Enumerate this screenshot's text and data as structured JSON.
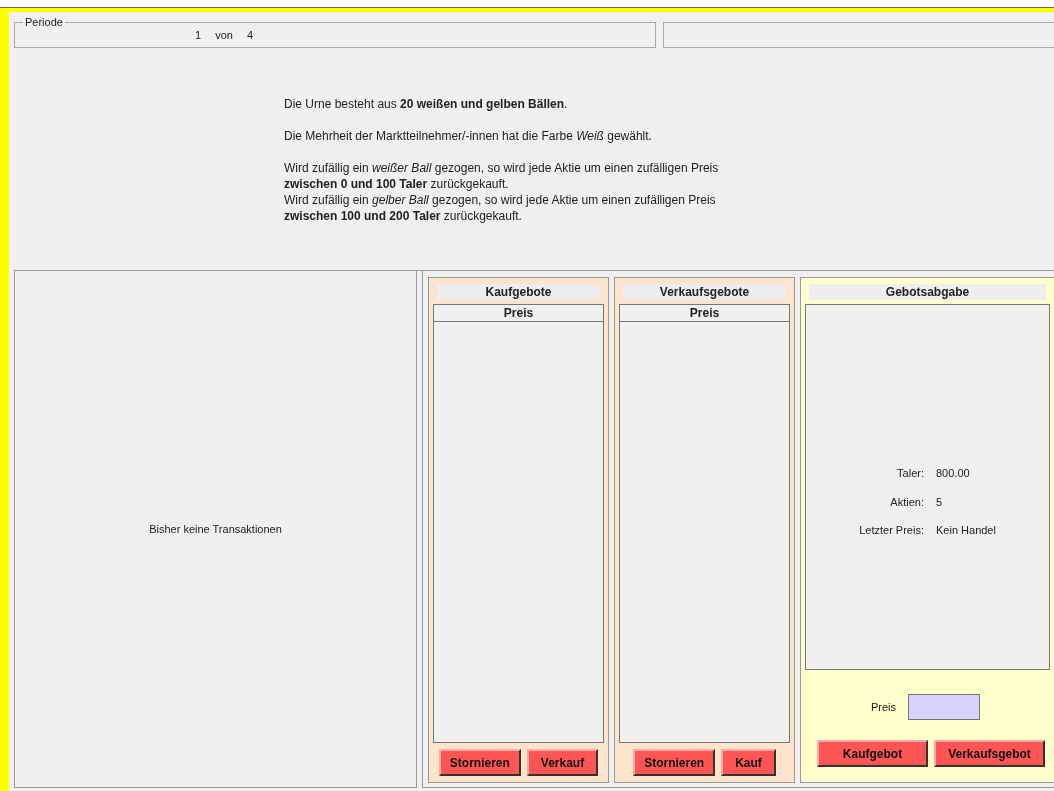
{
  "period": {
    "legend": "Periode",
    "current": "1",
    "separator": "von",
    "total": "4"
  },
  "info": {
    "paragraphs": [
      [
        "Die Urne besteht aus **20 weißen und gelben Bällen**."
      ],
      [
        "Die Mehrheit der Marktteilnehmer/-innen hat die Farbe *Weiß* gewählt."
      ],
      [
        "Wird zufällig ein *weißer Ball* gezogen, so wird jede Aktie um einen zufälligen Preis",
        "**zwischen 0 und 100 Taler** zurückgekauft.",
        "Wird zufällig ein *gelber Ball* gezogen, so wird jede Aktie um einen zufälligen Preis",
        "**zwischen 100 und 200 Taler** zurückgekauft."
      ]
    ]
  },
  "transactions": {
    "empty_message": "Bisher keine Transaktionen"
  },
  "order_books": [
    {
      "title": "Kaufgebote",
      "column": "Preis",
      "buttons": [
        "Stornieren",
        "Verkauf"
      ]
    },
    {
      "title": "Verkaufsgebote",
      "column": "Preis",
      "buttons": [
        "Stornieren",
        "Kauf"
      ]
    }
  ],
  "bid_panel": {
    "title": "Gebotsabgabe",
    "stats": [
      {
        "label": "Taler:",
        "value": "800.00"
      },
      {
        "label": "Aktien:",
        "value": "5"
      },
      {
        "label": "Letzter Preis:",
        "value": "Kein Handel"
      }
    ],
    "price_label": "Preis",
    "buttons": [
      "Kaufgebot",
      "Verkaufsgebot"
    ]
  }
}
